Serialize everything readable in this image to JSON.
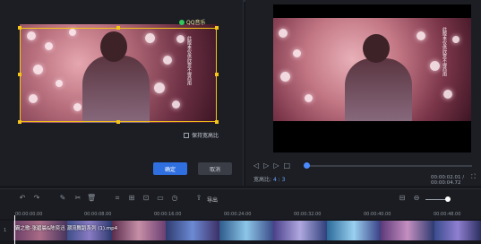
{
  "crop_panel": {
    "logo_text": "QQ音乐",
    "vertical_text": "此版本仅供欣赏不得商用",
    "keep_ratio_label": "保持宽高比",
    "confirm_label": "确定",
    "cancel_label": "取消"
  },
  "preview": {
    "aspect_label": "宽高比:",
    "aspect_value": "4 : 3",
    "timecode": "00:00:02.01 / 00:00:04.72",
    "progress": 0.0
  },
  "toolbar": {
    "export_label": "导出"
  },
  "timeline": {
    "ticks": [
      "00:00:00.00",
      "00:00:08.00",
      "00:00:16.00",
      "00:00:24.00",
      "00:00:32.00",
      "00:00:40.00",
      "00:00:48.00"
    ],
    "clip_label": "霸之歌-张碧晨&陈奕迅 潮流舞蹈系列 (1).mp4",
    "track_number": "1"
  },
  "colors": {
    "accent": "#2f6fe0",
    "crop_frame": "#f5c518",
    "background": "#16171c"
  }
}
